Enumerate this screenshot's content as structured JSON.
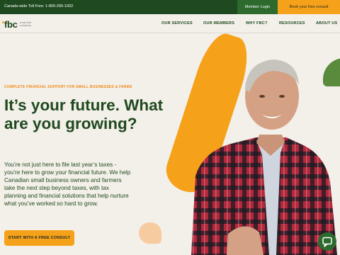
{
  "topbar": {
    "phone_text": "Canada-wide Toll Free: 1-800-265-1002",
    "member_login": "Member Login",
    "book_consult": "Book your free consult"
  },
  "brand": {
    "logo_text": "fbc",
    "logo_tagline": "a harvest company"
  },
  "nav": [
    {
      "label": "OUR SERVICES"
    },
    {
      "label": "OUR MEMBERS"
    },
    {
      "label": "WHY FBC?"
    },
    {
      "label": "RESOURCES"
    },
    {
      "label": "ABOUT US"
    }
  ],
  "hero": {
    "eyebrow": "COMPLETE FINANCIAL SUPPORT FOR SMALL BUSINESSES & FARMS",
    "headline": "It’s your future. What are you growing?",
    "body": "You’re not just here to file last year’s taxes - you’re here to grow your financial future. We help Canadian small business owners and farmers take the next step beyond taxes, with tax planning and financial solutions that help nurture what you’ve worked so hard to grow.",
    "cta": "START WITH A FREE CONSULT"
  },
  "colors": {
    "brand_green": "#1f4a1f",
    "accent_orange": "#f6a11a",
    "background": "#f3efe9"
  },
  "icons": {
    "chat": "chat-bubble-icon"
  }
}
